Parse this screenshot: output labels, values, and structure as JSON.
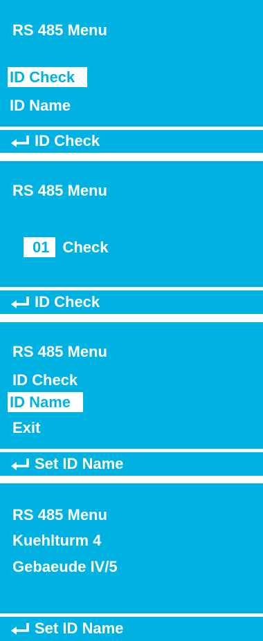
{
  "colors": {
    "panel": "#00b2e2",
    "text": "#ffffff"
  },
  "screens": [
    {
      "title": "RS 485 Menu",
      "items": [
        "ID Check",
        "ID Name"
      ],
      "selected": "ID Check",
      "footer_icon": "enter-return-icon",
      "footer": "ID Check"
    },
    {
      "title": "RS 485 Menu",
      "id_value": "01",
      "label": "Check",
      "footer_icon": "enter-return-icon",
      "footer": "ID Check"
    },
    {
      "title": "RS 485 Menu",
      "items": [
        "ID Check",
        "ID Name",
        "Exit"
      ],
      "selected": "ID Name",
      "footer_icon": "enter-return-icon",
      "footer": "Set ID Name"
    },
    {
      "title": "RS 485 Menu",
      "lines": [
        "Kuehlturm 4",
        "Gebaeude IV/5"
      ],
      "footer_icon": "enter-return-icon",
      "footer": "Set ID Name"
    }
  ]
}
